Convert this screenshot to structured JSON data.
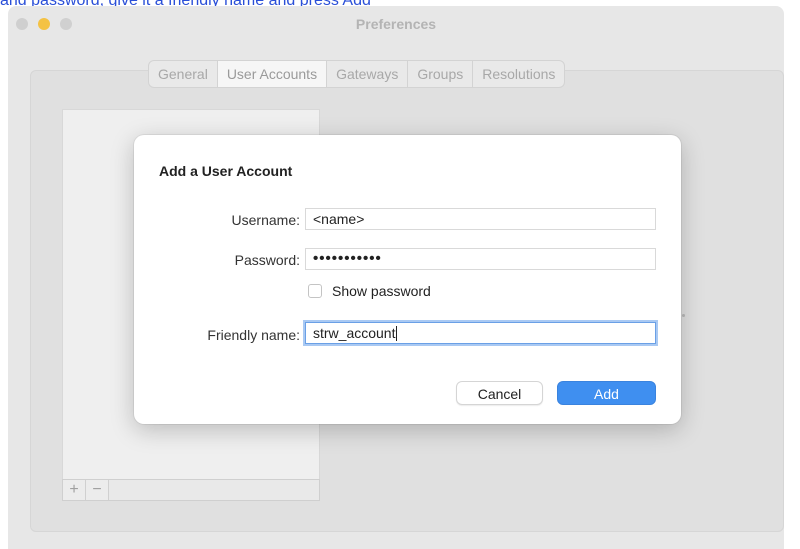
{
  "top_text": {
    "link": "and password, give it a friendly name and press Add",
    "dark": ""
  },
  "window": {
    "title": "Preferences",
    "tabs": [
      "General",
      "User Accounts",
      "Gateways",
      "Groups",
      "Resolutions"
    ],
    "active_tab": "User Accounts",
    "list_footer": {
      "add": "+",
      "remove": "−"
    }
  },
  "dialog": {
    "title": "Add a User Account",
    "username_label": "Username:",
    "username_value": "<name>",
    "password_label": "Password:",
    "password_value": "•••••••••••",
    "show_password_label": "Show password",
    "show_password_checked": false,
    "friendly_label": "Friendly name:",
    "friendly_value": "strw_account",
    "cancel_label": "Cancel",
    "add_label": "Add"
  },
  "colors": {
    "accent": "#3f8ff0",
    "link": "#2a4fd8"
  }
}
